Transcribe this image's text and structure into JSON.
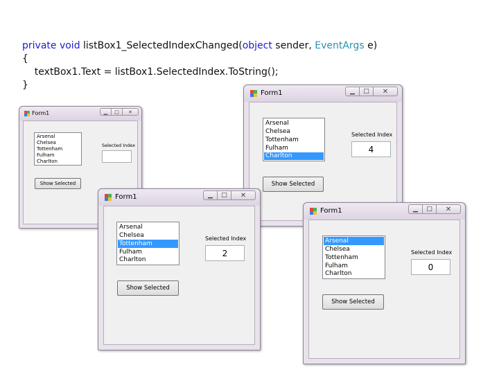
{
  "code": {
    "line1": {
      "kw1": "private void",
      "name": " listBox1_SelectedIndexChanged(",
      "kw2": "object",
      "mid": " sender, ",
      "ty": "EventArgs",
      "end": " e)"
    },
    "line2": "{",
    "line3": "    textBox1.Text = listBox1.SelectedIndex.ToString();",
    "line4": "}"
  },
  "windows": [
    {
      "title": "Form1",
      "min_glyph": "▁",
      "max_glyph": "□",
      "close_glyph": "✕",
      "items": [
        "Arsenal",
        "Chelsea",
        "Tottenham",
        "Fulham",
        "Charlton"
      ],
      "selected_label": "Selected Index",
      "selected_value": "",
      "button_label": "Show Selected"
    },
    {
      "title": "Form1",
      "min_glyph": "▁",
      "max_glyph": "□",
      "close_glyph": "✕",
      "items": [
        "Arsenal",
        "Chelsea",
        "Tottenham",
        "Fulham",
        "Charlton"
      ],
      "selected_label": "Selected Index",
      "selected_value": "2",
      "button_label": "Show Selected"
    },
    {
      "title": "Form1",
      "min_glyph": "▁",
      "max_glyph": "□",
      "close_glyph": "✕",
      "items": [
        "Arsenal",
        "Chelsea",
        "Tottenham",
        "Fulham",
        "Charlton"
      ],
      "selected_label": "Selected Index",
      "selected_value": "4",
      "button_label": "Show Selected"
    },
    {
      "title": "Form1",
      "min_glyph": "▁",
      "max_glyph": "□",
      "close_glyph": "✕",
      "items": [
        "Arsenal",
        "Chelsea",
        "Tottenham",
        "Fulham",
        "Charlton"
      ],
      "selected_label": "Selected Index",
      "selected_value": "0",
      "button_label": "Show Selected"
    }
  ]
}
